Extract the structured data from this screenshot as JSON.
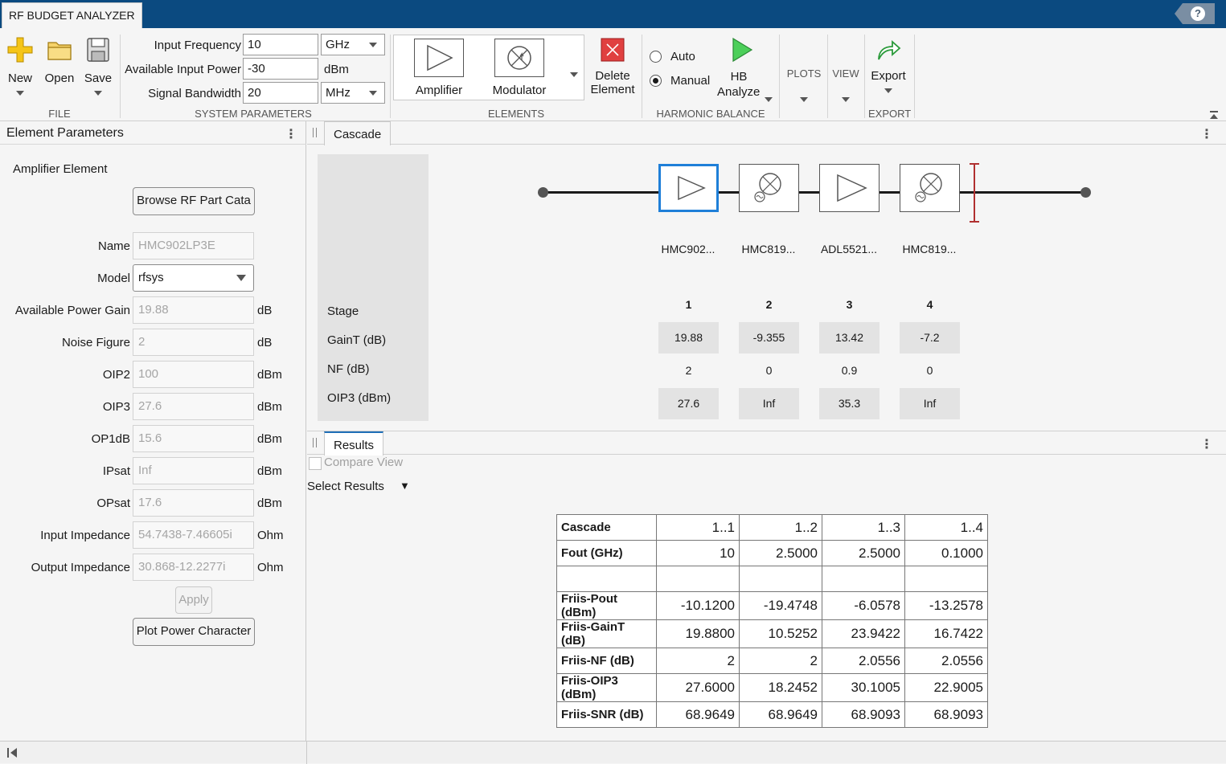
{
  "app": {
    "title": "RF BUDGET ANALYZER",
    "help": "?"
  },
  "toolstrip": {
    "file": {
      "section": "FILE",
      "new": "New",
      "open": "Open",
      "save": "Save"
    },
    "system": {
      "section": "SYSTEM PARAMETERS",
      "input_frequency_label": "Input Frequency",
      "input_frequency_value": "10",
      "input_frequency_unit": "GHz",
      "available_power_label": "Available Input Power",
      "available_power_value": "-30",
      "available_power_unit": "dBm",
      "bandwidth_label": "Signal Bandwidth",
      "bandwidth_value": "20",
      "bandwidth_unit": "MHz"
    },
    "elements": {
      "section": "ELEMENTS",
      "amplifier": "Amplifier",
      "modulator": "Modulator",
      "delete": "Delete",
      "delete2": "Element"
    },
    "harmonic": {
      "section": "HARMONIC BALANCE",
      "auto": "Auto",
      "manual": "Manual",
      "selected": "Manual",
      "hb": "HB",
      "analyze": "Analyze"
    },
    "plots": "PLOTS",
    "view": "VIEW",
    "export": {
      "section": "EXPORT",
      "label": "Export"
    }
  },
  "element_parameters": {
    "title": "Element Parameters",
    "element_type": "Amplifier Element",
    "browse_button": "Browse RF Part Cata",
    "fields": [
      {
        "label": "Name",
        "value": "HMC902LP3E",
        "unit": ""
      },
      {
        "label": "Model",
        "value": "rfsys",
        "unit": ""
      },
      {
        "label": "Available Power Gain",
        "value": "19.88",
        "unit": "dB"
      },
      {
        "label": "Noise Figure",
        "value": "2",
        "unit": "dB"
      },
      {
        "label": "OIP2",
        "value": "100",
        "unit": "dBm"
      },
      {
        "label": "OIP3",
        "value": "27.6",
        "unit": "dBm"
      },
      {
        "label": "OP1dB",
        "value": "15.6",
        "unit": "dBm"
      },
      {
        "label": "IPsat",
        "value": "Inf",
        "unit": "dBm"
      },
      {
        "label": "OPsat",
        "value": "17.6",
        "unit": "dBm"
      },
      {
        "label": "Input Impedance",
        "value": "54.7438-7.46605i",
        "unit": "Ohm"
      },
      {
        "label": "Output Impedance",
        "value": "30.868-12.2277i",
        "unit": "Ohm"
      }
    ],
    "apply_button": "Apply",
    "plot_button": "Plot Power Character"
  },
  "cascade": {
    "tab": "Cascade",
    "row_labels": {
      "stage": "Stage",
      "gain": "GainT (dB)",
      "nf": "NF (dB)",
      "oip3": "OIP3 (dBm)"
    },
    "stages": [
      {
        "name": "HMC902...",
        "num": "1",
        "gain": "19.88",
        "nf": "2",
        "oip3": "27.6",
        "type": "amplifier"
      },
      {
        "name": "HMC819...",
        "num": "2",
        "gain": "-9.355",
        "nf": "0",
        "oip3": "Inf",
        "type": "modulator"
      },
      {
        "name": "ADL5521...",
        "num": "3",
        "gain": "13.42",
        "nf": "0.9",
        "oip3": "35.3",
        "type": "amplifier"
      },
      {
        "name": "HMC819...",
        "num": "4",
        "gain": "-7.2",
        "nf": "0",
        "oip3": "Inf",
        "type": "modulator"
      }
    ]
  },
  "results": {
    "tab": "Results",
    "compare_view": "Compare View",
    "select_results": "Select Results",
    "rows": [
      {
        "label": "Cascade",
        "values": [
          "1..1",
          "1..2",
          "1..3",
          "1..4"
        ]
      },
      {
        "label": "Fout (GHz)",
        "values": [
          "10",
          "2.5000",
          "2.5000",
          "0.1000"
        ]
      },
      {
        "label": "",
        "values": [
          "",
          "",
          "",
          ""
        ]
      },
      {
        "label": "Friis-Pout (dBm)",
        "values": [
          "-10.1200",
          "-19.4748",
          "-6.0578",
          "-13.2578"
        ]
      },
      {
        "label": "Friis-GainT (dB)",
        "values": [
          "19.8800",
          "10.5252",
          "23.9422",
          "16.7422"
        ]
      },
      {
        "label": "Friis-NF (dB)",
        "values": [
          "2",
          "2",
          "2.0556",
          "2.0556"
        ]
      },
      {
        "label": "Friis-OIP3 (dBm)",
        "values": [
          "27.6000",
          "18.2452",
          "30.1005",
          "22.9005"
        ]
      },
      {
        "label": "Friis-SNR (dB)",
        "values": [
          "68.9649",
          "68.9649",
          "68.9093",
          "68.9093"
        ]
      }
    ]
  },
  "colors": {
    "titlebar": "#0b4a80",
    "selected_block": "#1f7fd8",
    "cursor": "#b03030",
    "run_green": "#3ab54a",
    "delete_red": "#e04040"
  }
}
